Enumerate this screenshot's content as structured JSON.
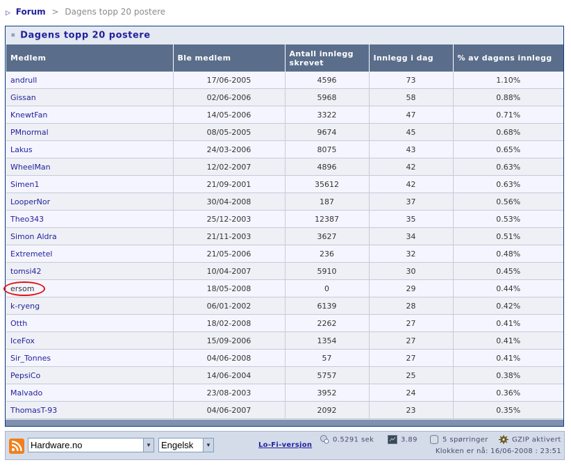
{
  "breadcrumb": {
    "root": "Forum",
    "separator": ">",
    "current": "Dagens topp 20 postere"
  },
  "panel": {
    "title": "Dagens topp 20 postere"
  },
  "table": {
    "headers": {
      "member": "Medlem",
      "joined": "Ble medlem",
      "total_posts": "Antall innlegg skrevet",
      "posts_today": "Innlegg i dag",
      "percent": "% av dagens innlegg"
    },
    "rows": [
      {
        "member": "andrull",
        "joined": "17/06-2005",
        "total": "4596",
        "today": "73",
        "percent": "1.10%"
      },
      {
        "member": "Gissan",
        "joined": "02/06-2006",
        "total": "5968",
        "today": "58",
        "percent": "0.88%"
      },
      {
        "member": "KnewtFan",
        "joined": "14/05-2006",
        "total": "3322",
        "today": "47",
        "percent": "0.71%"
      },
      {
        "member": "PMnormal",
        "joined": "08/05-2005",
        "total": "9674",
        "today": "45",
        "percent": "0.68%"
      },
      {
        "member": "Lakus",
        "joined": "24/03-2006",
        "total": "8075",
        "today": "43",
        "percent": "0.65%"
      },
      {
        "member": "WheelMan",
        "joined": "12/02-2007",
        "total": "4896",
        "today": "42",
        "percent": "0.63%"
      },
      {
        "member": "Simen1",
        "joined": "21/09-2001",
        "total": "35612",
        "today": "42",
        "percent": "0.63%"
      },
      {
        "member": "LooperNor",
        "joined": "30/04-2008",
        "total": "187",
        "today": "37",
        "percent": "0.56%"
      },
      {
        "member": "Theo343",
        "joined": "25/12-2003",
        "total": "12387",
        "today": "35",
        "percent": "0.53%"
      },
      {
        "member": "Simon Aldra",
        "joined": "21/11-2003",
        "total": "3627",
        "today": "34",
        "percent": "0.51%"
      },
      {
        "member": "Extremetel",
        "joined": "21/05-2006",
        "total": "236",
        "today": "32",
        "percent": "0.48%"
      },
      {
        "member": "tomsi42",
        "joined": "10/04-2007",
        "total": "5910",
        "today": "30",
        "percent": "0.45%"
      },
      {
        "member": "ersom",
        "joined": "18/05-2008",
        "total": "0",
        "today": "29",
        "percent": "0.44%"
      },
      {
        "member": "k-ryeng",
        "joined": "06/01-2002",
        "total": "6139",
        "today": "28",
        "percent": "0.42%"
      },
      {
        "member": "Otth",
        "joined": "18/02-2008",
        "total": "2262",
        "today": "27",
        "percent": "0.41%"
      },
      {
        "member": "IceFox",
        "joined": "15/09-2006",
        "total": "1354",
        "today": "27",
        "percent": "0.41%"
      },
      {
        "member": "Sir_Tonnes",
        "joined": "04/06-2008",
        "total": "57",
        "today": "27",
        "percent": "0.41%"
      },
      {
        "member": "PepsiCo",
        "joined": "14/06-2004",
        "total": "5757",
        "today": "25",
        "percent": "0.38%"
      },
      {
        "member": "Malvado",
        "joined": "23/08-2003",
        "total": "3952",
        "today": "24",
        "percent": "0.36%"
      },
      {
        "member": "ThomasT-93",
        "joined": "04/06-2007",
        "total": "2092",
        "today": "23",
        "percent": "0.35%"
      }
    ]
  },
  "footer": {
    "forum_select": "Hardware.no",
    "language_select": "Engelsk",
    "lofi_link": "Lo-Fi-versjon",
    "load_time": "0.5291 sek",
    "server_load": "3.89",
    "queries": "5 spørringer",
    "gzip": "GZIP aktivert",
    "clock": "Klokken er nå: 16/06-2008 : 23:51"
  },
  "colors": {
    "header_bg": "#5a6d8b",
    "link": "#22229c",
    "panel_border": "#0b3b7c",
    "highlight_circle": "#e01010"
  },
  "icons": [
    "arrow-icon",
    "rss-icon",
    "dropdown-arrow-icon",
    "load-time-icon",
    "server-load-icon",
    "database-icon",
    "gzip-icon"
  ]
}
